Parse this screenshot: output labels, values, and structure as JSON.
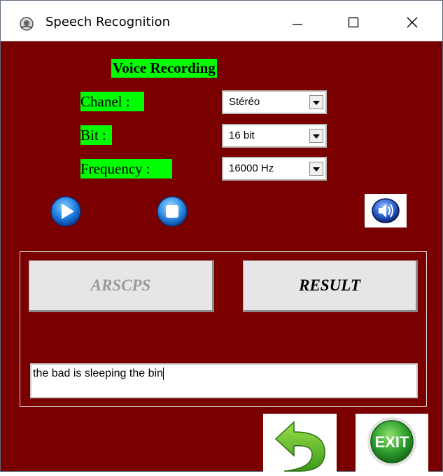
{
  "window": {
    "title": "Speech Recognition",
    "controls": {
      "minimize": "—",
      "maximize": "☐",
      "close": "✕"
    }
  },
  "form": {
    "heading": "Voice Recording",
    "chanel": {
      "label": "Chanel :",
      "value": "Stéréo"
    },
    "bit": {
      "label": "Bit :",
      "value": "16 bit"
    },
    "frequency": {
      "label": "Frequency :",
      "value": "16000 Hz"
    }
  },
  "actions": {
    "arscps_label": "ARSCPS",
    "result_label": "RESULT",
    "exit_label": "EXIT"
  },
  "output": {
    "text": "the bad is sleeping the bin"
  },
  "icons": {
    "play": "play-icon",
    "stop": "stop-icon",
    "speaker": "speaker-icon",
    "back": "back-arrow-icon",
    "exit": "exit-icon"
  },
  "colors": {
    "background": "#7a0000",
    "label_highlight": "#00ff00",
    "icon_blue": "#1f7fe0",
    "exit_green": "#2fa02f"
  }
}
